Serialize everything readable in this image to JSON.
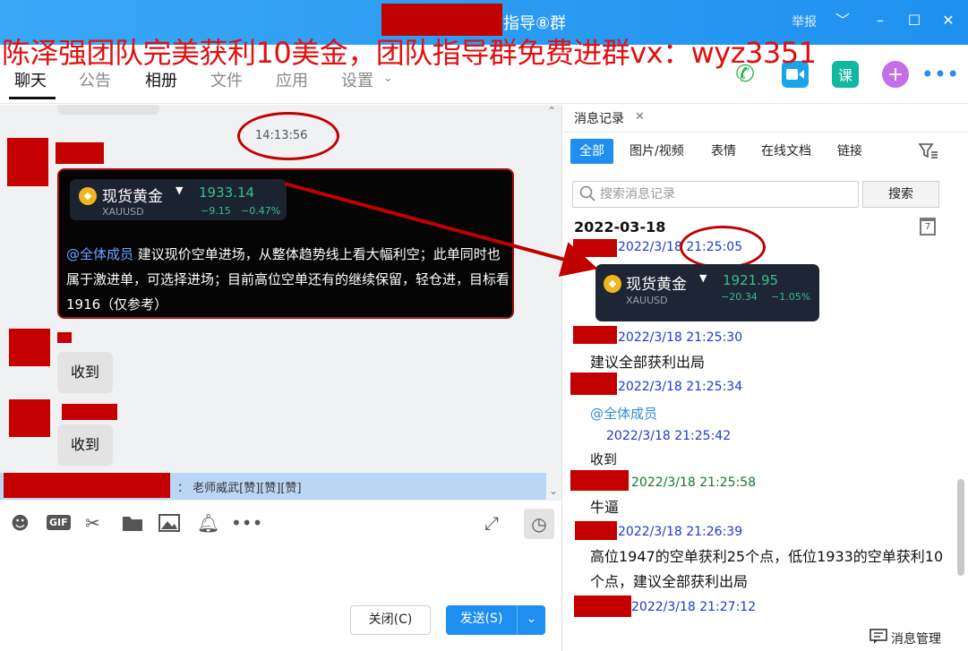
{
  "window": {
    "title": "指导⑧群",
    "report": "举报",
    "minimize": "﹀",
    "restore": "–",
    "maximize": "☐",
    "close": "✕"
  },
  "overlay_text": "陈泽强团队完美获利10美金，团队指导群免费进群vx：wyz3351",
  "tabs": [
    "聊天",
    "公告",
    "相册",
    "文件",
    "应用",
    "设置"
  ],
  "header_icons": {
    "course_label": "课"
  },
  "chat": {
    "timestamp": "14:13:56",
    "quote_card": {
      "name": "现货黄金",
      "symbol": "XAUUSD",
      "price": "1933.14",
      "change": "−9.15",
      "change_pct": "−0.47%"
    },
    "mention": "@全体成员",
    "message": " 建议现价空单进场，从整体趋势线上看大幅利空；此单同时也属于激进单，可选择进场；目前高位空单还有的继续保留，轻仓进，目标看1916（仅参考）",
    "reply1": "收到",
    "reply2": "收到",
    "notice": "： 老师威武[赞][赞][赞]"
  },
  "toolbar": {
    "gif_label": "GIF"
  },
  "input": {
    "close_label": "关闭(C)",
    "send_label": "发送(S)"
  },
  "history": {
    "tab_label": "消息记录",
    "filters": [
      "全部",
      "图片/视频",
      "表情",
      "在线文档",
      "链接"
    ],
    "search_placeholder": "搜索消息记录",
    "search_button": "搜索",
    "date": "2022-03-18",
    "calendar_day": "7",
    "quote_card": {
      "name": "现货黄金",
      "symbol": "XAUUSD",
      "price": "1921.95",
      "change": "−20.34",
      "change_pct": "−1.05%"
    },
    "records": [
      {
        "time": "2022/3/18 21:25:05"
      },
      {
        "time": "2022/3/18 21:25:30",
        "text": "建议全部获利出局"
      },
      {
        "time": "2022/3/18 21:25:34",
        "text": "@全体成员"
      },
      {
        "time": "2022/3/18 21:25:42",
        "text": "收到"
      },
      {
        "time": "2022/3/18 21:25:58",
        "text": "牛逼"
      },
      {
        "time": "2022/3/18 21:26:39",
        "text": "高位1947的空单获利25个点，低位1933的空单获利10个点，建议全部获利出局"
      },
      {
        "time": "2022/3/18 21:27:12"
      }
    ],
    "footer_label": "消息管理"
  }
}
